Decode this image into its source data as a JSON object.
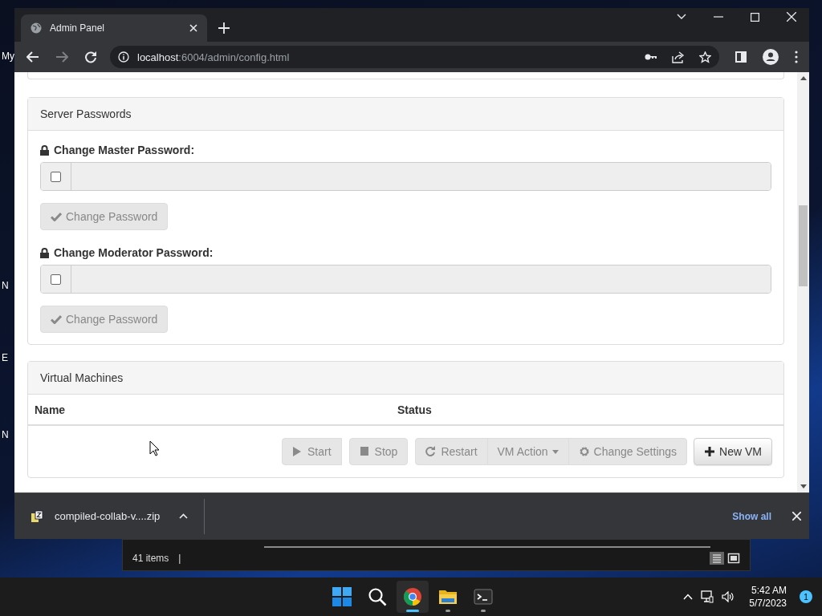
{
  "desktop": {
    "labels": [
      "My",
      "N",
      "E",
      "N"
    ]
  },
  "browser": {
    "tab": {
      "title": "Admin Panel",
      "selected": true
    },
    "address": {
      "host": "localhost",
      "path": ":6004/admin/config.html"
    },
    "panels": [
      {
        "kind": "passwords",
        "title": "Server Passwords",
        "fields": [
          {
            "label": "Change Master Password:",
            "checked": false,
            "button": "Change Password",
            "disabled": true
          },
          {
            "label": "Change Moderator Password:",
            "checked": false,
            "button": "Change Password",
            "disabled": true
          }
        ]
      },
      {
        "kind": "vms",
        "title": "Virtual Machines",
        "columns": [
          "Name",
          "Status"
        ],
        "buttons": [
          {
            "label": "Start",
            "kind": "play",
            "disabled": true
          },
          {
            "label": "Stop",
            "kind": "stop",
            "disabled": true
          },
          {
            "label": "Restart",
            "kind": "restart",
            "disabled": true
          },
          {
            "label": "VM Action",
            "kind": "dropdown",
            "disabled": true
          },
          {
            "label": "Change Settings",
            "kind": "settings",
            "disabled": true
          },
          {
            "label": "New VM",
            "kind": "add",
            "disabled": false
          }
        ]
      }
    ],
    "downloads": {
      "file": "compiled-collab-v....zip",
      "show_all": "Show all"
    }
  },
  "explorer": {
    "status": "41 items",
    "separator": "|"
  },
  "taskbar": {
    "apps": [
      {
        "kind": "start",
        "selected": false
      },
      {
        "kind": "search",
        "selected": false
      },
      {
        "kind": "chrome",
        "selected": true
      },
      {
        "kind": "files",
        "selected": false
      },
      {
        "kind": "terminal",
        "selected": false
      }
    ],
    "time": "5:42 AM",
    "date": "5/7/2023",
    "notifications": "1"
  }
}
